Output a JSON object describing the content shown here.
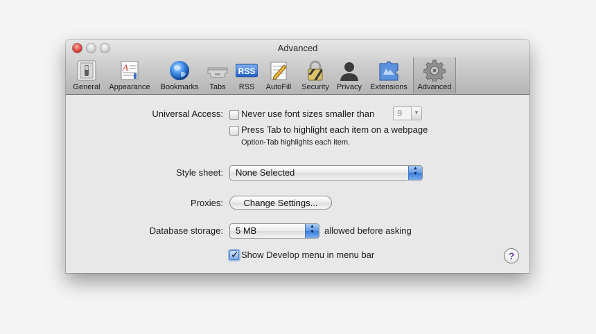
{
  "window": {
    "title": "Advanced"
  },
  "toolbar": {
    "items": [
      {
        "label": "General",
        "icon": "general-switch-icon"
      },
      {
        "label": "Appearance",
        "icon": "appearance-icon"
      },
      {
        "label": "Bookmarks",
        "icon": "globe-icon"
      },
      {
        "label": "Tabs",
        "icon": "tabs-icon"
      },
      {
        "label": "RSS",
        "icon": "rss-icon",
        "icon_text": "RSS"
      },
      {
        "label": "AutoFill",
        "icon": "autofill-pencil-icon"
      },
      {
        "label": "Security",
        "icon": "lock-icon"
      },
      {
        "label": "Privacy",
        "icon": "person-silhouette-icon"
      },
      {
        "label": "Extensions",
        "icon": "puzzle-piece-icon"
      },
      {
        "label": "Advanced",
        "icon": "gear-icon",
        "selected": true
      }
    ]
  },
  "advanced": {
    "universal_access": {
      "label": "Universal Access:",
      "min_font_option": {
        "label": "Never use font sizes smaller than",
        "checked": false
      },
      "min_font_size": "9",
      "tab_option": {
        "label": "Press Tab to highlight each item on a webpage",
        "checked": false
      },
      "tab_hint": "Option-Tab highlights each item."
    },
    "style_sheet": {
      "label": "Style sheet:",
      "value": "None Selected"
    },
    "proxies": {
      "label": "Proxies:",
      "button_label": "Change Settings..."
    },
    "database_storage": {
      "label": "Database storage:",
      "value": "5 MB",
      "suffix": "allowed before asking"
    },
    "develop_menu": {
      "label": "Show Develop menu in menu bar",
      "checked": true
    },
    "help_label": "?"
  },
  "colors": {
    "accent_blue": "#5f98e4",
    "close_red": "#e0443b",
    "help_purple": "#6a3fa0"
  }
}
